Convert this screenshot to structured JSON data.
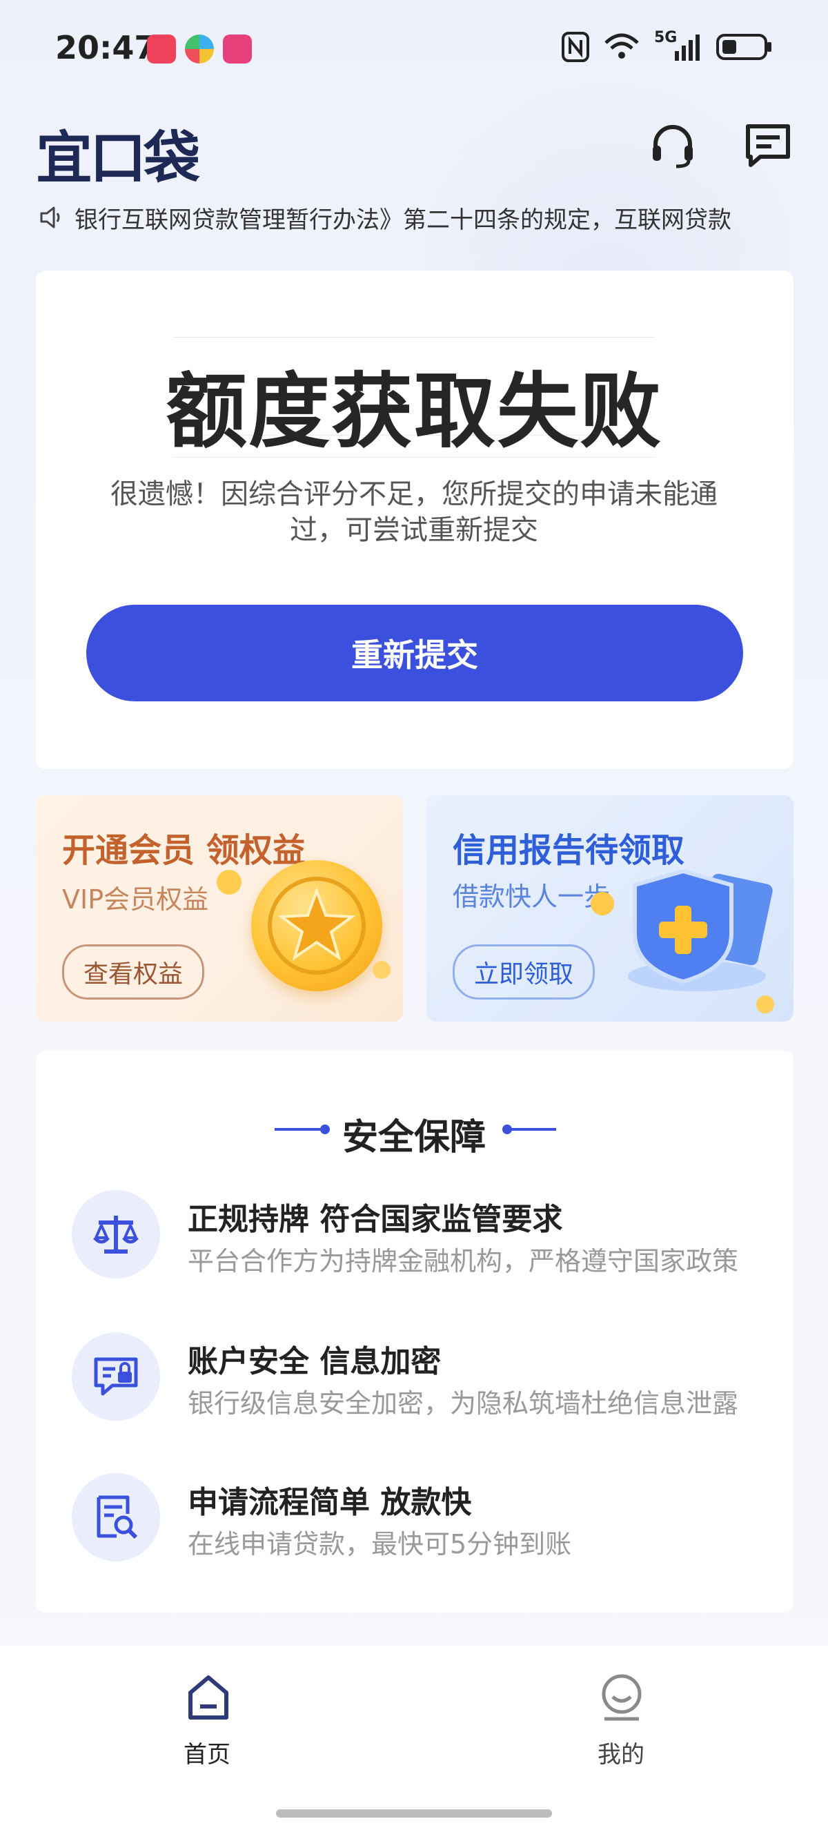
{
  "status_bar": {
    "time": "20:47",
    "network": "5G"
  },
  "header": {
    "logo": "宜口袋",
    "support_icon": "headset-icon",
    "message_icon": "message-icon"
  },
  "notice": {
    "icon": "speaker-icon",
    "text": "银行互联网贷款管理暂行办法》第二十四条的规定，互联网贷款"
  },
  "result": {
    "title": "额度获取失败",
    "description": "很遗憾！因综合评分不足，您所提交的申请未能通过，可尝试重新提交",
    "button": "重新提交"
  },
  "promos": [
    {
      "title": "开通会员 领权益",
      "subtitle": "VIP会员权益",
      "button": "查看权益",
      "accent": "#c4622d"
    },
    {
      "title": "信用报告待领取",
      "subtitle": "借款快人一步",
      "button": "立即领取",
      "accent": "#2f5fd8"
    }
  ],
  "security": {
    "title": "安全保障",
    "items": [
      {
        "icon": "scale-icon",
        "title": "正规持牌 符合国家监管要求",
        "desc": "平台合作方为持牌金融机构，严格遵守国家政策"
      },
      {
        "icon": "secure-account-icon",
        "title": "账户安全 信息加密",
        "desc": "银行级信息安全加密，为隐私筑墙杜绝信息泄露"
      },
      {
        "icon": "quick-application-icon",
        "title": "申请流程简单 放款快",
        "desc": "在线申请贷款，最快可5分钟到账"
      }
    ]
  },
  "bottom_nav": [
    {
      "label": "首页",
      "icon": "home-icon",
      "active": true
    },
    {
      "label": "我的",
      "icon": "profile-icon",
      "active": false
    }
  ],
  "colors": {
    "primary": "#3b51dd",
    "logo": "#1e2a55"
  }
}
